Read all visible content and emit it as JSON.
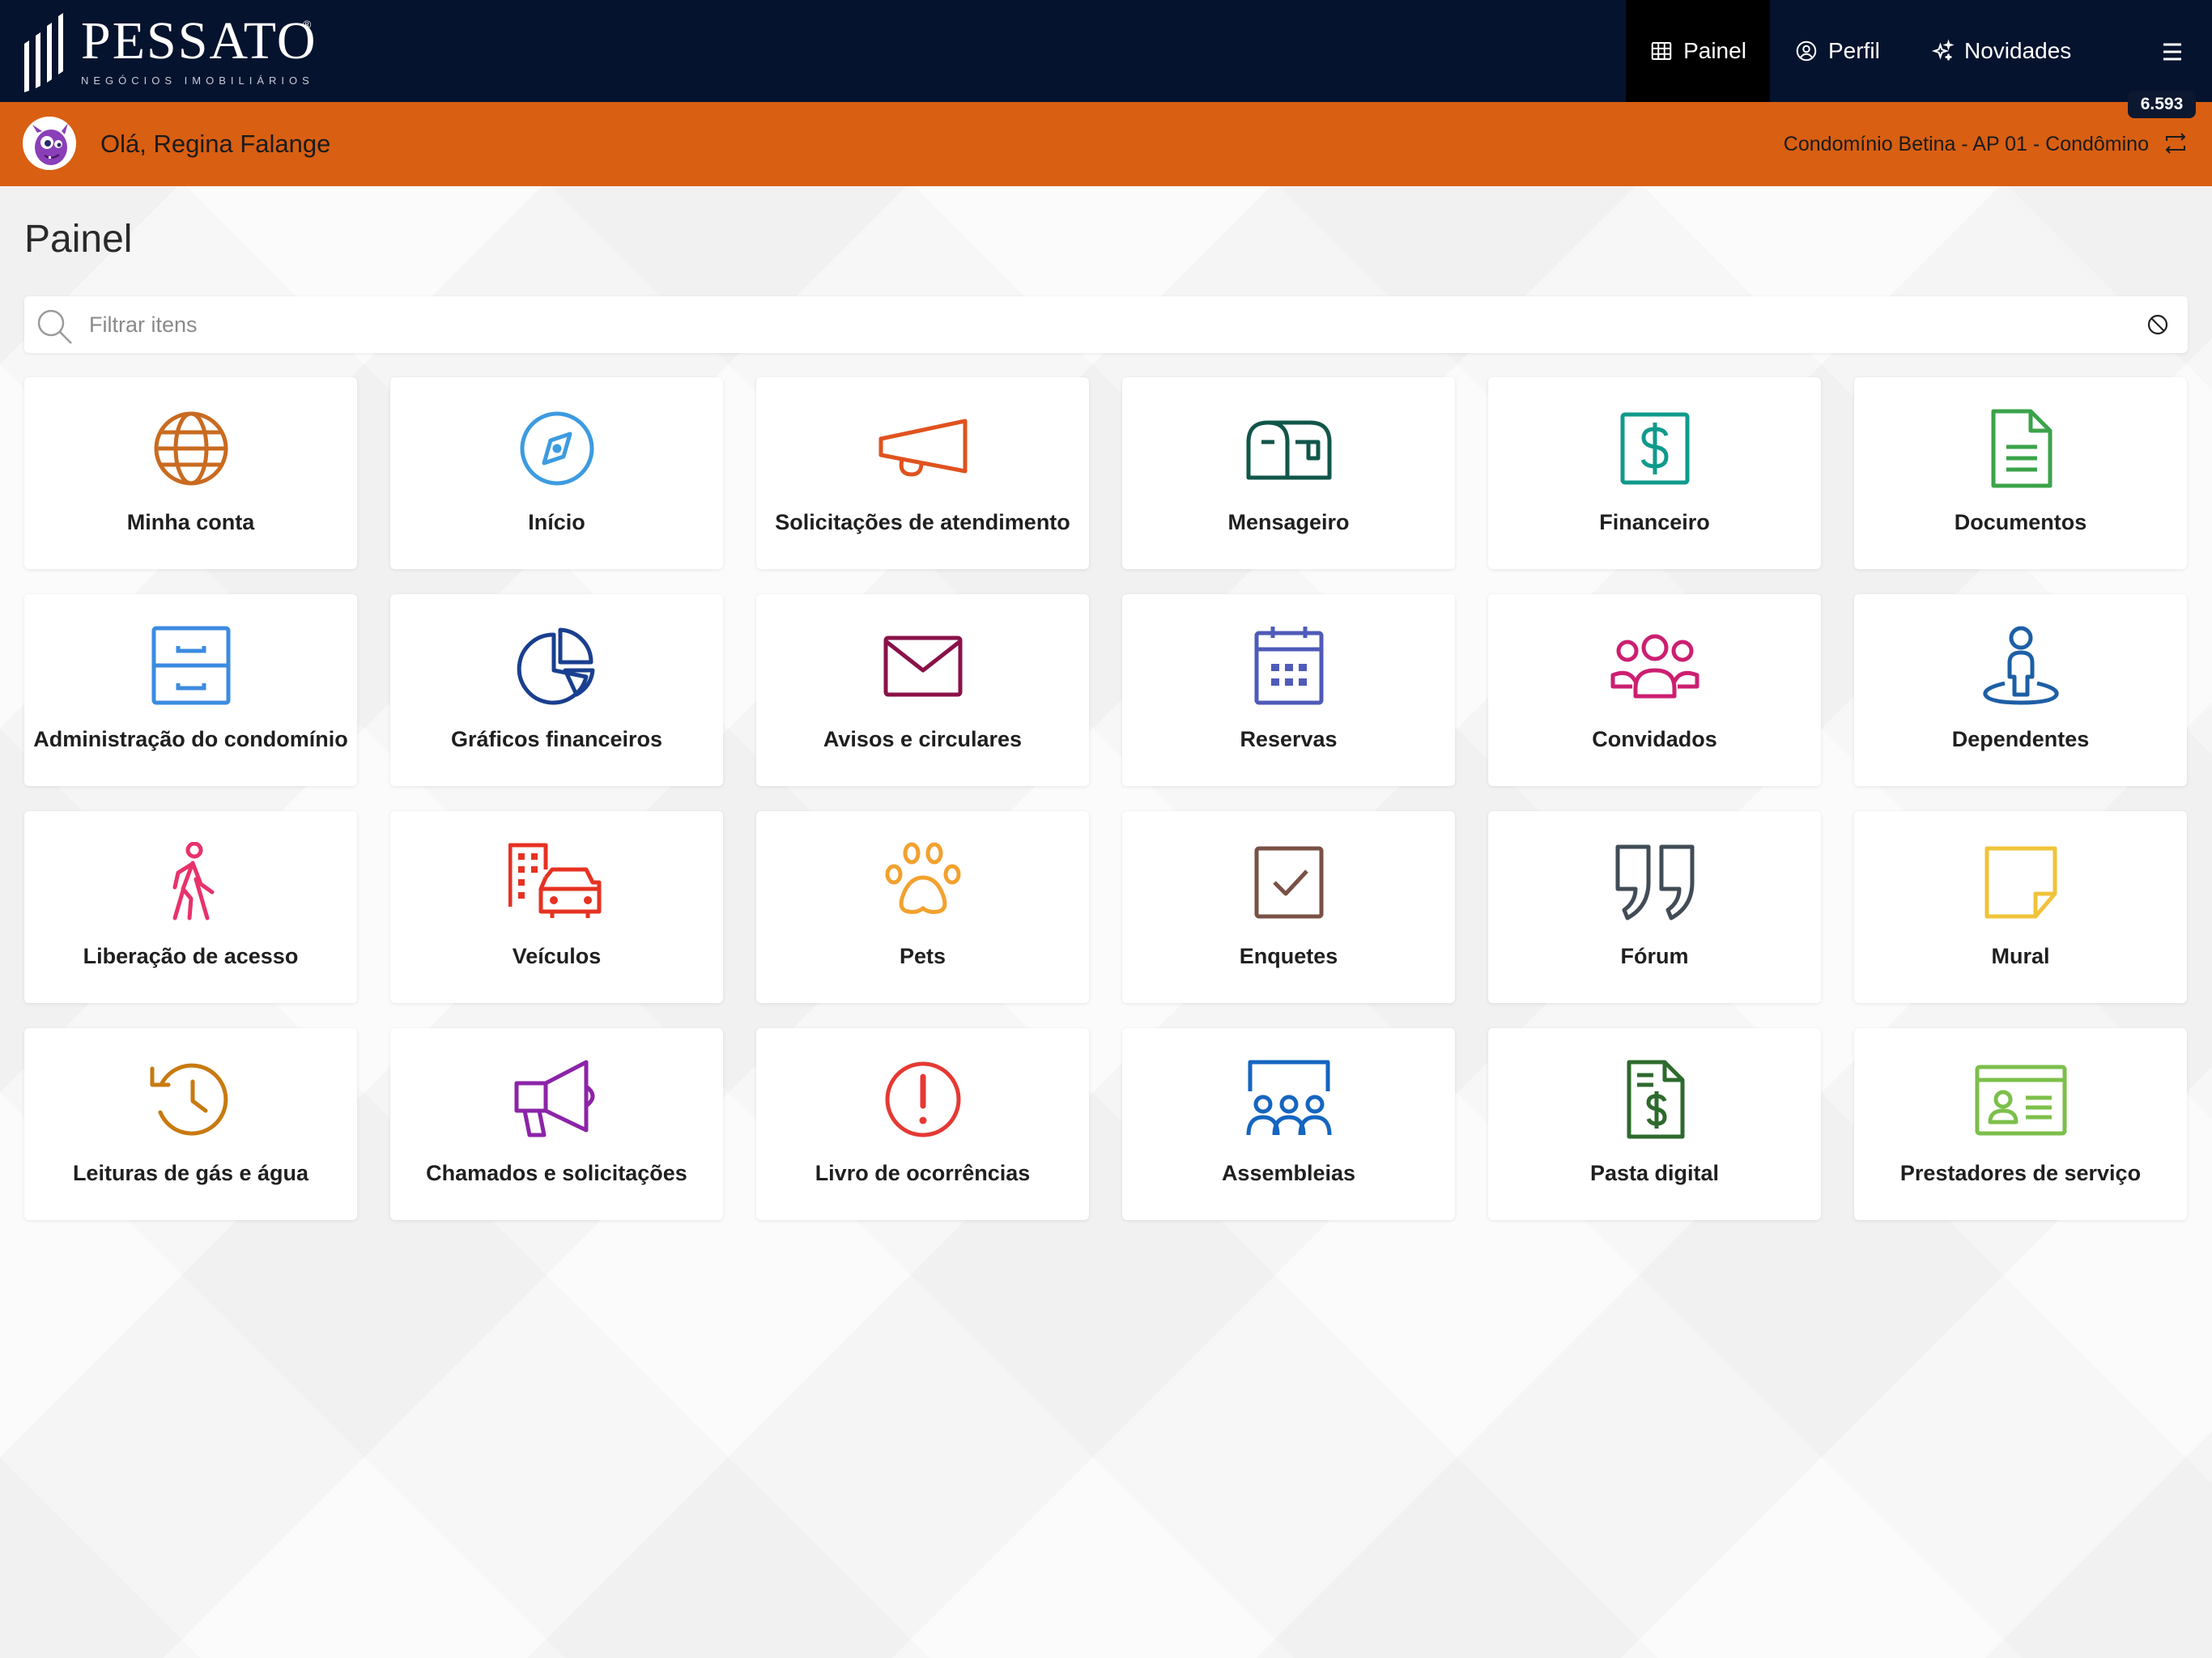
{
  "brand": {
    "name": "PESSATO",
    "registered": "®",
    "tagline": "NEGÓCIOS IMOBILIÁRIOS"
  },
  "nav": {
    "painel": "Painel",
    "perfil": "Perfil",
    "novidades": "Novidades",
    "badge": "6.593"
  },
  "user": {
    "greeting": "Olá, Regina Falange",
    "unit": "Condomínio Betina - AP 01 - Condômino"
  },
  "page": {
    "title": "Painel",
    "search_placeholder": "Filtrar itens",
    "search_value": ""
  },
  "colors": {
    "navbar": "#06132e",
    "userbar": "#d95f12"
  },
  "tiles": [
    {
      "label": "Minha conta",
      "icon": "globe-icon",
      "color": "#c96b20"
    },
    {
      "label": "Início",
      "icon": "compass-icon",
      "color": "#3d9be0"
    },
    {
      "label": "Solicitações de atendimento",
      "icon": "megaphone-outline-icon",
      "color": "#e0521e"
    },
    {
      "label": "Mensageiro",
      "icon": "mailbox-icon",
      "color": "#11564a"
    },
    {
      "label": "Financeiro",
      "icon": "dollar-square-icon",
      "color": "#109a8c"
    },
    {
      "label": "Documentos",
      "icon": "document-icon",
      "color": "#3ba34a"
    },
    {
      "label": "Administração do condomínio",
      "icon": "cabinet-icon",
      "color": "#3c8be0"
    },
    {
      "label": "Gráficos financeiros",
      "icon": "pie-chart-icon",
      "color": "#1a3f8f"
    },
    {
      "label": "Avisos e circulares",
      "icon": "envelope-icon",
      "color": "#8a1248"
    },
    {
      "label": "Reservas",
      "icon": "calendar-icon",
      "color": "#4f5bb8"
    },
    {
      "label": "Convidados",
      "icon": "group-icon",
      "color": "#cc1f71"
    },
    {
      "label": "Dependentes",
      "icon": "person-pin-icon",
      "color": "#1d5fa5"
    },
    {
      "label": "Liberação de acesso",
      "icon": "walking-icon",
      "color": "#e8326b"
    },
    {
      "label": "Veículos",
      "icon": "city-car-icon",
      "color": "#e63222"
    },
    {
      "label": "Pets",
      "icon": "paw-icon",
      "color": "#f2a12e"
    },
    {
      "label": "Enquetes",
      "icon": "checkbox-icon",
      "color": "#7a5145"
    },
    {
      "label": "Fórum",
      "icon": "quote-icon",
      "color": "#414c57"
    },
    {
      "label": "Mural",
      "icon": "sticky-note-icon",
      "color": "#f0c33a"
    },
    {
      "label": "Leituras de gás e água",
      "icon": "history-icon",
      "color": "#c77a10"
    },
    {
      "label": "Chamados e solicitações",
      "icon": "bullhorn-icon",
      "color": "#8c24a8"
    },
    {
      "label": "Livro de ocorrências",
      "icon": "alert-circle-icon",
      "color": "#e53935"
    },
    {
      "label": "Assembleias",
      "icon": "assembly-icon",
      "color": "#1565c0"
    },
    {
      "label": "Pasta digital",
      "icon": "invoice-icon",
      "color": "#2d6a2d"
    },
    {
      "label": "Prestadores de serviço",
      "icon": "id-card-icon",
      "color": "#7cbf4a"
    }
  ]
}
